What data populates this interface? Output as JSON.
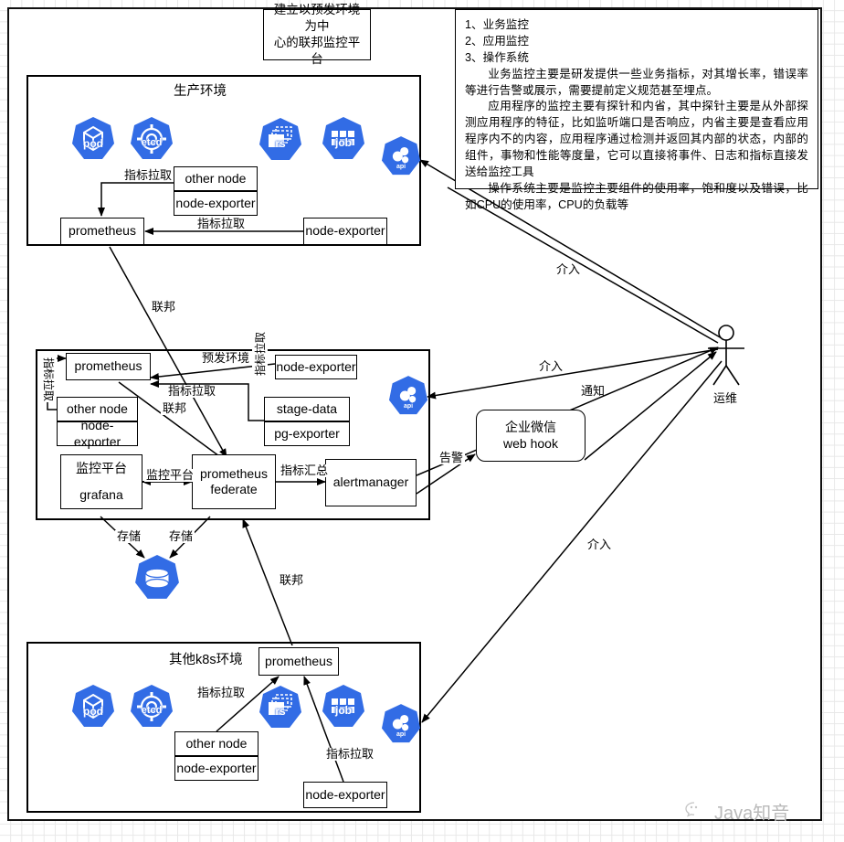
{
  "page": {
    "title_box": {
      "line1": "建立以预发环境为中",
      "line2": "心的联邦监控平台"
    },
    "note": {
      "item1": "1、业务监控",
      "item2": "2、应用监控",
      "item3": "3、操作系统",
      "para1": "业务监控主要是研发提供一些业务指标，对其增长率，错误率等进行告警或展示，需要提前定义规范甚至埋点。",
      "para2": "应用程序的监控主要有探针和内省，其中探针主要是从外部探测应用程序的特征，比如监听端口是否响应，内省主要是查看应用程序内不的内容，应用程序通过检测并返回其内部的状态，内部的组件，事物和性能等度量，它可以直接将事件、日志和指标直接发送给监控工具",
      "para3": "操作系统主要是监控主要组件的使用率，饱和度以及错误，比如CPU的使用率，CPU的负载等"
    },
    "watermark": "Java知音"
  },
  "production_env": {
    "title": "生产环境",
    "icons": [
      {
        "name": "pod",
        "label": "pod",
        "glyph": "cube"
      },
      {
        "name": "etcd",
        "label": "etcd",
        "glyph": "gearring"
      },
      {
        "name": "rs",
        "label": "rs",
        "glyph": "replicaset"
      },
      {
        "name": "job",
        "label": "job",
        "glyph": "grid"
      },
      {
        "name": "api",
        "label": "api",
        "glyph": "apiserver"
      }
    ],
    "other_node": "other node",
    "other_node_exporter": "node-exporter",
    "prometheus": "prometheus",
    "node_exporter": "node-exporter",
    "edge_pull_left": "指标拉取",
    "edge_pull_right": "指标拉取"
  },
  "stage_env": {
    "prometheus": "prometheus",
    "other_node": "other node",
    "other_node_exporter": "node-exporter",
    "node_exporter": "node-exporter",
    "stage_data": "stage-data",
    "pg_exporter": "pg-exporter",
    "grafana_title": "监控平台",
    "grafana_name": "grafana",
    "federate_line1": "prometheus",
    "federate_line2": "federate",
    "alertmanager": "alertmanager",
    "api_icon_label": "api",
    "storage_icon_name": "persistent-volume",
    "edge_stage_env": "预发环境",
    "edge_pull_vertical_left": "指标拉取",
    "edge_pull_vertical_right": "指标拉取",
    "edge_pull_center": "指标拉取",
    "edge_federation_inner": "联邦",
    "edge_monitor_platform": "监控平台",
    "edge_metric_summary": "指标汇总",
    "edge_storage_left": "存储",
    "edge_storage_right": "存储"
  },
  "other_k8s_env": {
    "title": "其他k8s环境",
    "prometheus": "prometheus",
    "other_node": "other node",
    "other_node_exporter": "node-exporter",
    "node_exporter": "node-exporter",
    "edge_pull_upper": "指标拉取",
    "edge_pull_lower": "指标拉取",
    "icons": [
      {
        "name": "pod",
        "label": "pod",
        "glyph": "cube"
      },
      {
        "name": "etcd",
        "label": "etcd",
        "glyph": "gearring"
      },
      {
        "name": "rs",
        "label": "rs",
        "glyph": "replicaset"
      },
      {
        "name": "job",
        "label": "job",
        "glyph": "grid"
      },
      {
        "name": "api",
        "label": "api",
        "glyph": "apiserver"
      }
    ]
  },
  "right_side": {
    "actor_label": "运维",
    "wechat_line1": "企业微信",
    "wechat_line2": "web hook",
    "edge_intervene_top": "介入",
    "edge_intervene_mid": "介入",
    "edge_intervene_bottom": "介入",
    "edge_notify": "通知",
    "edge_alert": "告警"
  },
  "federation_labels": {
    "top": "联邦",
    "bottom": "联邦"
  },
  "colors": {
    "k8s_blue": "#326ce5",
    "line": "#000000",
    "grid": "#e8e8e8",
    "watermark": "#b9b9b9"
  }
}
